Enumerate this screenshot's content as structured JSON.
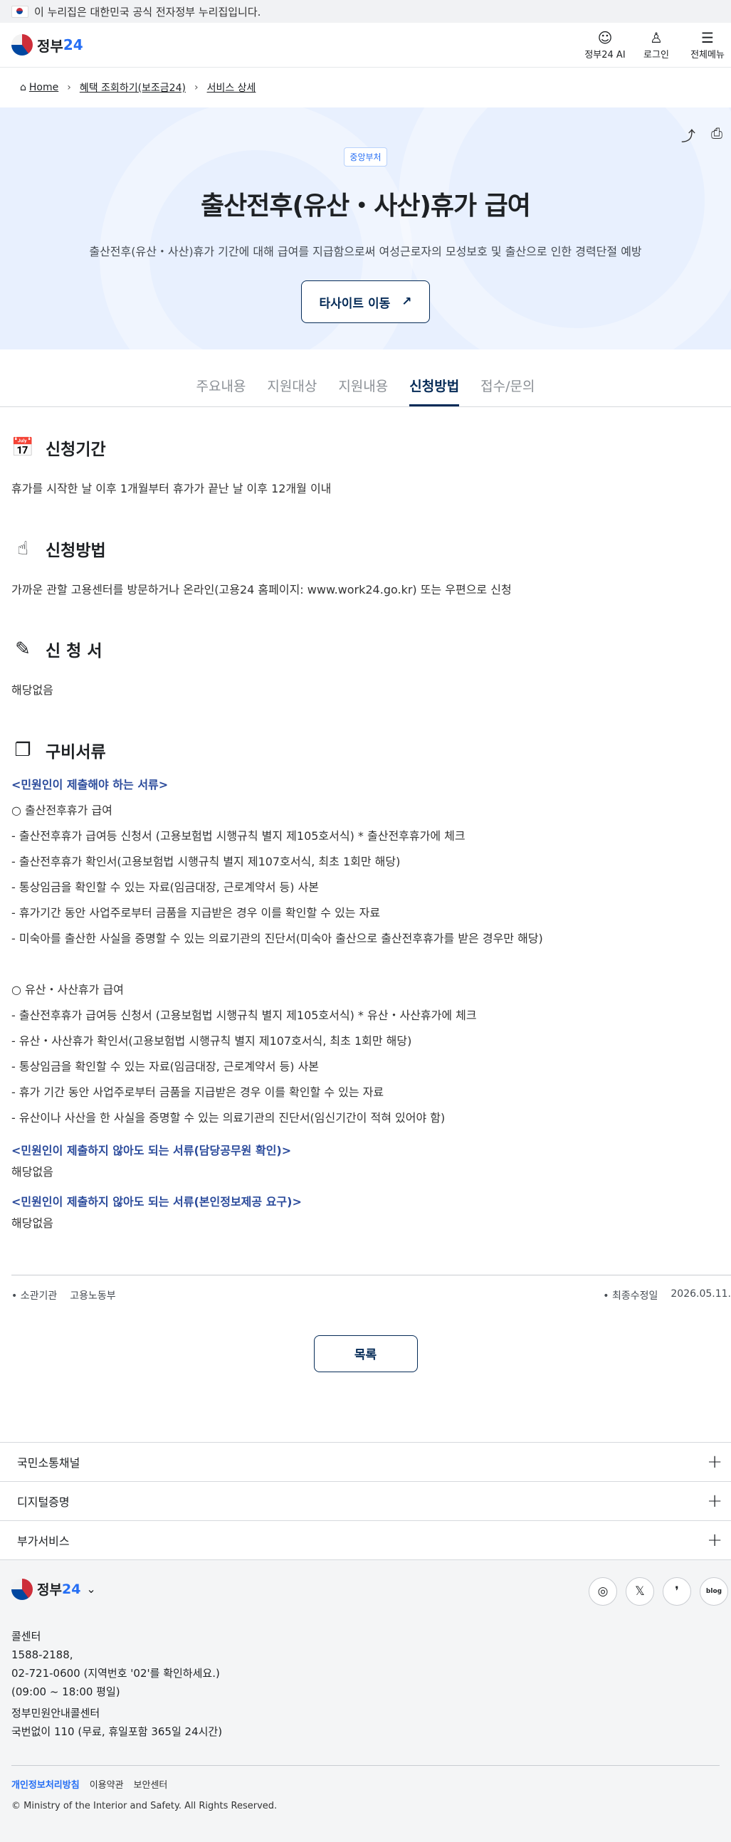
{
  "gov_banner": "이 누리집은 대한민국 공식 전자정부 누리집입니다.",
  "header": {
    "logo_text": "정부",
    "logo_num": "24",
    "buttons": [
      {
        "icon": "ai-robot-icon",
        "label": "정부24 AI"
      },
      {
        "icon": "user-icon",
        "label": "로그인"
      },
      {
        "icon": "menu-icon",
        "label": "전체메뉴"
      }
    ]
  },
  "breadcrumb": [
    "Home",
    "혜택 조회하기(보조금24)",
    "서비스 상세"
  ],
  "hero": {
    "tag": "중앙부처",
    "title": "출산전후(유산・사산)휴가 급여",
    "subtitle": "출산전후(유산・사산)휴가 기간에 대해 급여를 지급함으로써 여성근로자의 모성보호 및 출산으로 인한 경력단절 예방",
    "button": "타사이트 이동"
  },
  "tabs": [
    "주요내용",
    "지원대상",
    "지원내용",
    "신청방법",
    "접수/문의"
  ],
  "active_tab": "신청방법",
  "sections": {
    "period": {
      "title": "신청기간",
      "body": "휴가를 시작한 날 이후 1개월부터 휴가가 끝난 날 이후 12개월 이내"
    },
    "method": {
      "title": "신청방법",
      "body": "가까운 관할 고용센터를 방문하거나 온라인(고용24 홈페이지: www.work24.go.kr) 또는 우편으로 신청"
    },
    "form": {
      "title": "신 청 서",
      "body": "해당없음"
    },
    "docs": {
      "title": "구비서류",
      "head1": "<민원인이 제출해야 하는 서류>",
      "group1_title": "○ 출산전후휴가 급여",
      "group1": [
        "- 출산전후휴가 급여등 신청서 (고용보험법 시행규칙 별지 제105호서식) * 출산전후휴가에 체크",
        "- 출산전후휴가 확인서(고용보험법 시행규칙 별지 제107호서식, 최초 1회만 해당)",
        "- 통상임금을 확인할 수 있는 자료(임금대장, 근로계약서 등) 사본",
        "- 휴가기간 동안 사업주로부터 금품을 지급받은 경우 이를 확인할 수 있는 자료",
        "- 미숙아를 출산한 사실을 증명할 수 있는 의료기관의 진단서(미숙아 출산으로 출산전후휴가를 받은 경우만 해당)"
      ],
      "group2_title": "○ 유산・사산휴가 급여",
      "group2": [
        "- 출산전후휴가 급여등 신청서 (고용보험법 시행규칙 별지 제105호서식) * 유산・사산휴가에 체크",
        "- 유산・사산휴가 확인서(고용보험법 시행규칙 별지 제107호서식, 최초 1회만 해당)",
        "- 통상임금을 확인할 수 있는 자료(임금대장, 근로계약서 등) 사본",
        "- 휴가 기간 동안 사업주로부터 금품을 지급받은 경우 이를 확인할 수 있는 자료",
        "- 유산이나 사산을 한 사실을 증명할 수 있는 의료기관의 진단서(임신기간이 적혀 있어야 함)"
      ],
      "head2": "<민원인이 제출하지 않아도 되는 서류(담당공무원 확인)>",
      "head2_body": "해당없음",
      "head3": "<민원인이 제출하지 않아도 되는 서류(본인정보제공 요구)>",
      "head3_body": "해당없음"
    }
  },
  "meta": {
    "agency_label": "소관기관",
    "agency_value": "고용노동부",
    "updated_label": "최종수정일",
    "updated_value": "2026.05.11."
  },
  "list_button": "목록",
  "accordion": [
    "국민소통채널",
    "디지털증명",
    "부가서비스"
  ],
  "footer": {
    "logo_text": "정부",
    "logo_num": "24",
    "socials": [
      "instagram-icon",
      "x-icon",
      "blog-comma-icon",
      "naver-blog-icon"
    ],
    "call_label": "콜센터",
    "call_num1": "1588-2188,",
    "call_num2": "02-721-0600 (지역번호 '02'를 확인하세요.)",
    "call_hours": "(09:00 ~ 18:00 평일)",
    "center_label": "정부민원안내콜센터",
    "center_value": "국번없이 110 (무료, 휴일포함 365일 24시간)",
    "links": [
      "개인정보처리방침",
      "이용약관",
      "보안센터"
    ],
    "copyright": "© Ministry of the Interior and Safety. All Rights Reserved."
  }
}
